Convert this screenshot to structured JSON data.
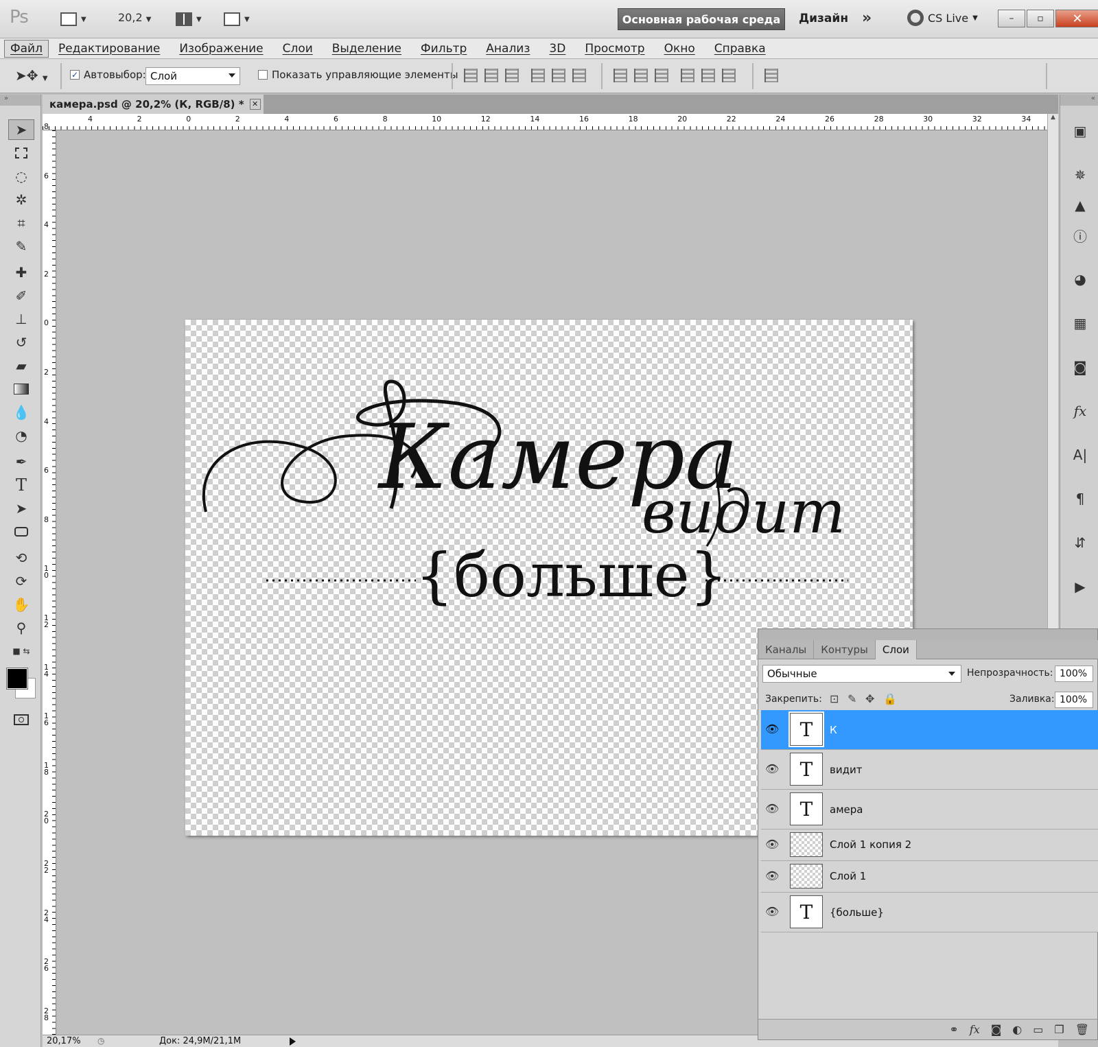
{
  "app": {
    "logo": "Ps",
    "zoom_field": "20,2"
  },
  "workspace": {
    "primary": "Основная рабочая среда",
    "design": "Дизайн",
    "more": "»",
    "cslive": "CS Live"
  },
  "window_buttons": {
    "minimize": "–",
    "restore": "▫",
    "close": "✕"
  },
  "menu": [
    "Файл",
    "Редактирование",
    "Изображение",
    "Слои",
    "Выделение",
    "Фильтр",
    "Анализ",
    "3D",
    "Просмотр",
    "Окно",
    "Справка"
  ],
  "options": {
    "auto_select_label": "Автовыбор:",
    "auto_select_value": "Слой",
    "show_controls_label": "Показать управляющие элементы"
  },
  "document": {
    "tab_title": "камера.psd @ 20,2% (К, RGB/8) *"
  },
  "ruler_top": [
    "4",
    "2",
    "0",
    "2",
    "4",
    "6",
    "8",
    "10",
    "12",
    "14",
    "16",
    "18",
    "20",
    "22",
    "24",
    "26",
    "28",
    "30",
    "32",
    "34"
  ],
  "ruler_left": [
    "8",
    "6",
    "4",
    "2",
    "0",
    "2",
    "4",
    "6",
    "8",
    "1 0",
    "1 2",
    "1 4",
    "1 6",
    "1 8",
    "2 0",
    "2 2",
    "2 4",
    "2 6",
    "2 8"
  ],
  "artwork": {
    "word1": "Камера",
    "word2": "видит",
    "word3": "{больше}"
  },
  "status": {
    "zoom": "20,17%",
    "doc": "Док: 24,9M/21,1M"
  },
  "layers_panel": {
    "tabs": [
      "Каналы",
      "Контуры",
      "Слои"
    ],
    "active_tab": "Слои",
    "blend_mode": "Обычные",
    "opacity_label": "Непрозрачность:",
    "opacity": "100%",
    "lock_label": "Закрепить:",
    "fill_label": "Заливка:",
    "fill": "100%",
    "layers": [
      {
        "name": "К",
        "type": "text",
        "selected": true
      },
      {
        "name": "видит",
        "type": "text",
        "selected": false
      },
      {
        "name": "амера",
        "type": "text",
        "selected": false
      },
      {
        "name": "Слой 1 копия 2",
        "type": "pixel",
        "selected": false
      },
      {
        "name": "Слой 1",
        "type": "pixel",
        "selected": false
      },
      {
        "name": "{больше}",
        "type": "text",
        "selected": false
      }
    ]
  },
  "colors": {
    "selection": "#3399ff",
    "canvas_bg": "#c0c0c0"
  }
}
